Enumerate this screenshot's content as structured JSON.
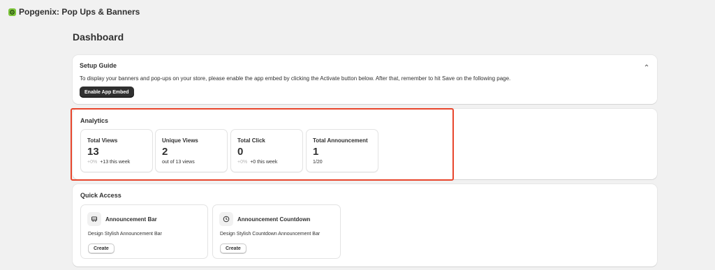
{
  "app": {
    "title": "Popgenix: Pop Ups & Banners",
    "logo_icon": "popgenix-logo",
    "logo_color": "#7cc43a"
  },
  "page": {
    "title": "Dashboard"
  },
  "setup_guide": {
    "title": "Setup Guide",
    "description": "To display your banners and pop-ups on your store, please enable the app embed by clicking the Activate button below. After that, remember to hit Save on the following page.",
    "button_label": "Enable App Embed",
    "collapse_icon": "chevron-up-icon"
  },
  "analytics": {
    "title": "Analytics",
    "highlight_color": "#e8452c",
    "stats": [
      {
        "label": "Total Views",
        "value": "13",
        "change": "+0%",
        "note": "+13 this week"
      },
      {
        "label": "Unique Views",
        "value": "2",
        "change": "",
        "note": "out of 13 views"
      },
      {
        "label": "Total Click",
        "value": "0",
        "change": "+0%",
        "note": "+0 this week"
      },
      {
        "label": "Total Announcement",
        "value": "1",
        "change": "",
        "note": "1/20"
      }
    ]
  },
  "quick_access": {
    "title": "Quick Access",
    "items": [
      {
        "title": "Announcement Bar",
        "description": "Design Stylish Announcement Bar",
        "button_label": "Create",
        "icon": "announcement-bar-icon"
      },
      {
        "title": "Announcement Countdown",
        "description": "Design Stylish Countdown Announcement Bar",
        "button_label": "Create",
        "icon": "clock-icon"
      }
    ]
  }
}
